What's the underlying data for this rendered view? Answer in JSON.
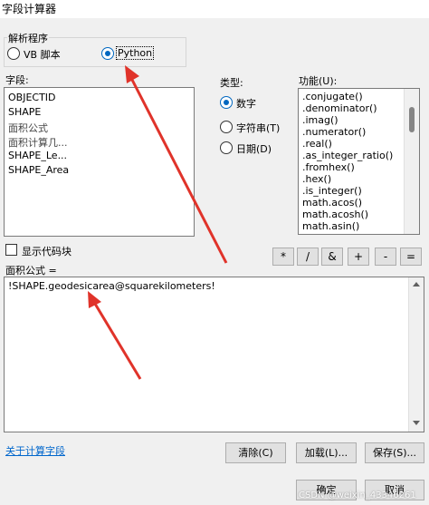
{
  "window": {
    "title": "字段计算器"
  },
  "parser": {
    "group_label": "解析程序",
    "options": [
      "VB 脚本",
      "Python"
    ],
    "selected": "Python"
  },
  "fields": {
    "label": "字段:",
    "items": [
      "OBJECTID",
      "SHAPE",
      "面积公式",
      "面积计算几...",
      "SHAPE_Le...",
      "SHAPE_Area"
    ]
  },
  "type": {
    "label": "类型:",
    "options": [
      "数字",
      "字符串(T)",
      "日期(D)"
    ],
    "selected": "数字"
  },
  "functions": {
    "label": "功能(U):",
    "items": [
      ".conjugate()",
      ".denominator()",
      ".imag()",
      ".numerator()",
      ".real()",
      ".as_integer_ratio()",
      ".fromhex()",
      ".hex()",
      ".is_integer()",
      "math.acos()",
      "math.acosh()",
      "math.asin()"
    ]
  },
  "show_codeblock": {
    "label": "显示代码块",
    "checked": false
  },
  "operators": [
    "*",
    "/",
    "&",
    "+",
    "-",
    "="
  ],
  "expression": {
    "label": "面积公式 =",
    "value": "!SHAPE.geodesicarea@squarekilometers!"
  },
  "footer": {
    "help_link": "关于计算字段",
    "clear": "清除(C)",
    "load": "加载(L)...",
    "save": "保存(S)...",
    "ok": "确定",
    "cancel": "取消"
  },
  "watermark": "CSDN @weixin_43346261",
  "annotation_color": "#e0332a"
}
